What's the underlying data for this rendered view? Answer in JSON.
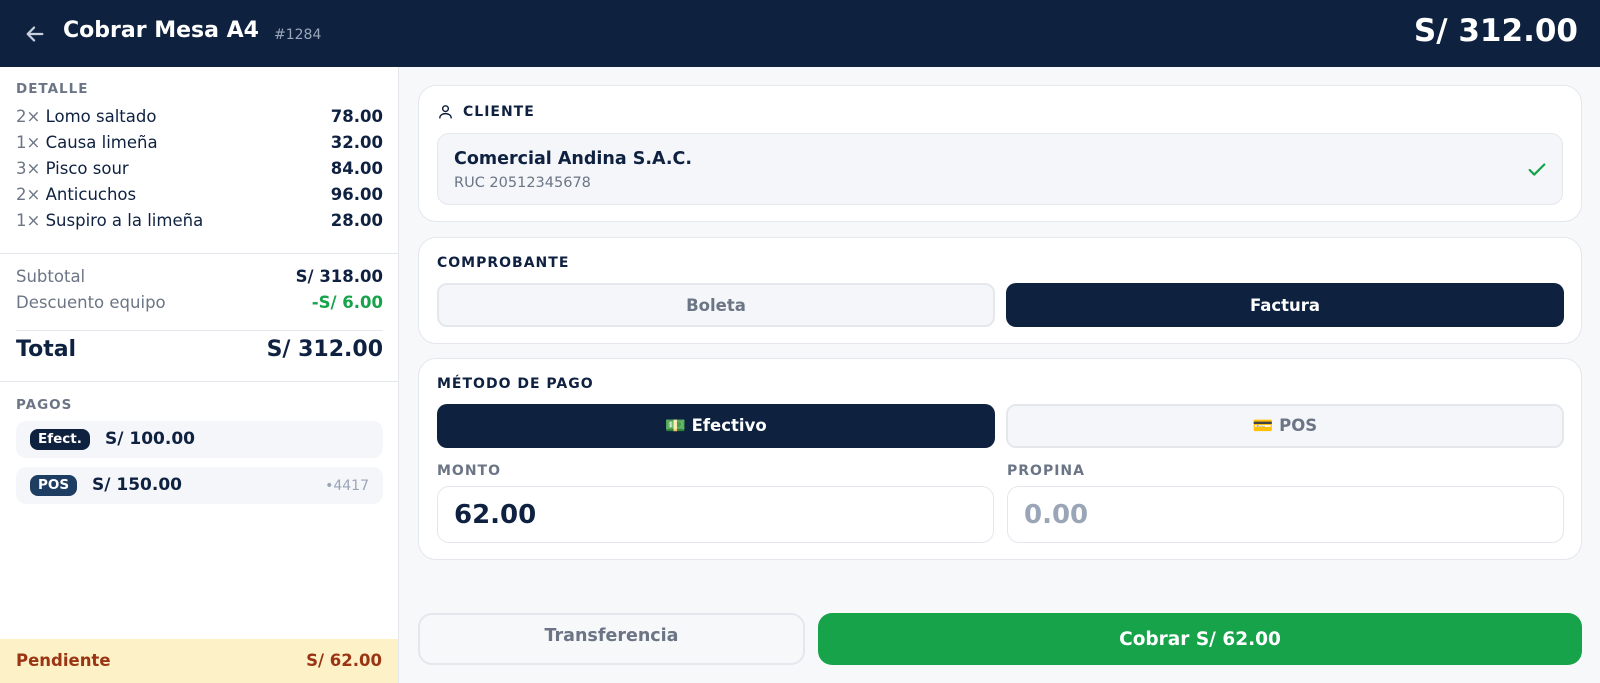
{
  "header": {
    "title": "Cobrar Mesa A4",
    "order_number": "#1284",
    "total": "S/ 312.00"
  },
  "detail": {
    "label": "DETALLE",
    "items": [
      {
        "qty": "2×",
        "name": "Lomo saltado",
        "price": "78.00"
      },
      {
        "qty": "1×",
        "name": "Causa limeña",
        "price": "32.00"
      },
      {
        "qty": "3×",
        "name": "Pisco sour",
        "price": "84.00"
      },
      {
        "qty": "2×",
        "name": "Anticuchos",
        "price": "96.00"
      },
      {
        "qty": "1×",
        "name": "Suspiro a la limeña",
        "price": "28.00"
      }
    ]
  },
  "summary": {
    "subtotal_label": "Subtotal",
    "subtotal_value": "S/ 318.00",
    "discount_label": "Descuento equipo",
    "discount_value": "-S/ 6.00",
    "total_label": "Total",
    "total_value": "S/ 312.00"
  },
  "payments": {
    "label": "PAGOS",
    "items": [
      {
        "method": "Efect.",
        "amount": "S/ 100.00",
        "ref": ""
      },
      {
        "method": "POS",
        "amount": "S/ 150.00",
        "ref": "•4417"
      }
    ]
  },
  "pending": {
    "label": "Pendiente",
    "value": "S/ 62.00"
  },
  "client": {
    "label": "CLIENTE",
    "name": "Comercial Andina S.A.C.",
    "ruc": "RUC 20512345678",
    "verified": true
  },
  "receipt": {
    "label": "COMPROBANTE",
    "options": [
      "Boleta",
      "Factura"
    ],
    "selected": "Factura"
  },
  "payment_method": {
    "label": "MÉTODO DE PAGO",
    "cash_label": "💵 Efectivo",
    "pos_label": "💳 POS",
    "selected": "Efectivo",
    "amount_label": "MONTO",
    "amount_value": "62.00",
    "tip_label": "PROPINA",
    "tip_placeholder": "0.00"
  },
  "actions": {
    "transfer_label": "Transferencia",
    "charge_label": "Cobrar S/ 62.00"
  },
  "colors": {
    "navy": "#0e2240",
    "green": "#16a34a",
    "pending_bg": "#fdf1c7",
    "pending_text": "#9a3412"
  }
}
